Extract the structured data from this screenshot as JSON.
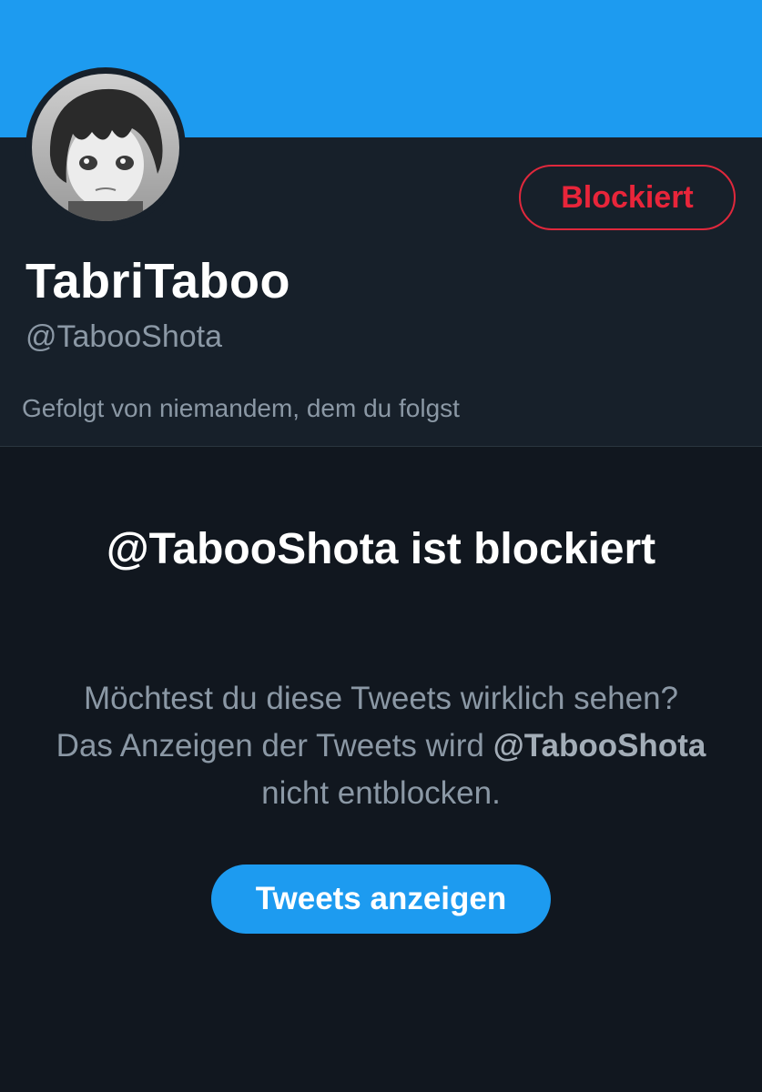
{
  "profile": {
    "display_name": "TabriTaboo",
    "handle": "@TabooShota",
    "followed_by": "Gefolgt von niemandem, dem du folgst",
    "blocked_button_label": "Blockiert"
  },
  "blocked_notice": {
    "title": "@TabooShota ist blockiert",
    "text_part1": "Möchtest du diese Tweets wirklich sehen? Das Anzeigen der Tweets wird",
    "text_handle": "@TabooShota",
    "text_part2": "nicht entblocken.",
    "show_button_label": "Tweets anzeigen"
  },
  "colors": {
    "banner": "#1d9bf0",
    "background": "#11171f",
    "card_background": "#17202a",
    "blocked_red": "#e8253a",
    "secondary_text": "#8b98a5"
  }
}
